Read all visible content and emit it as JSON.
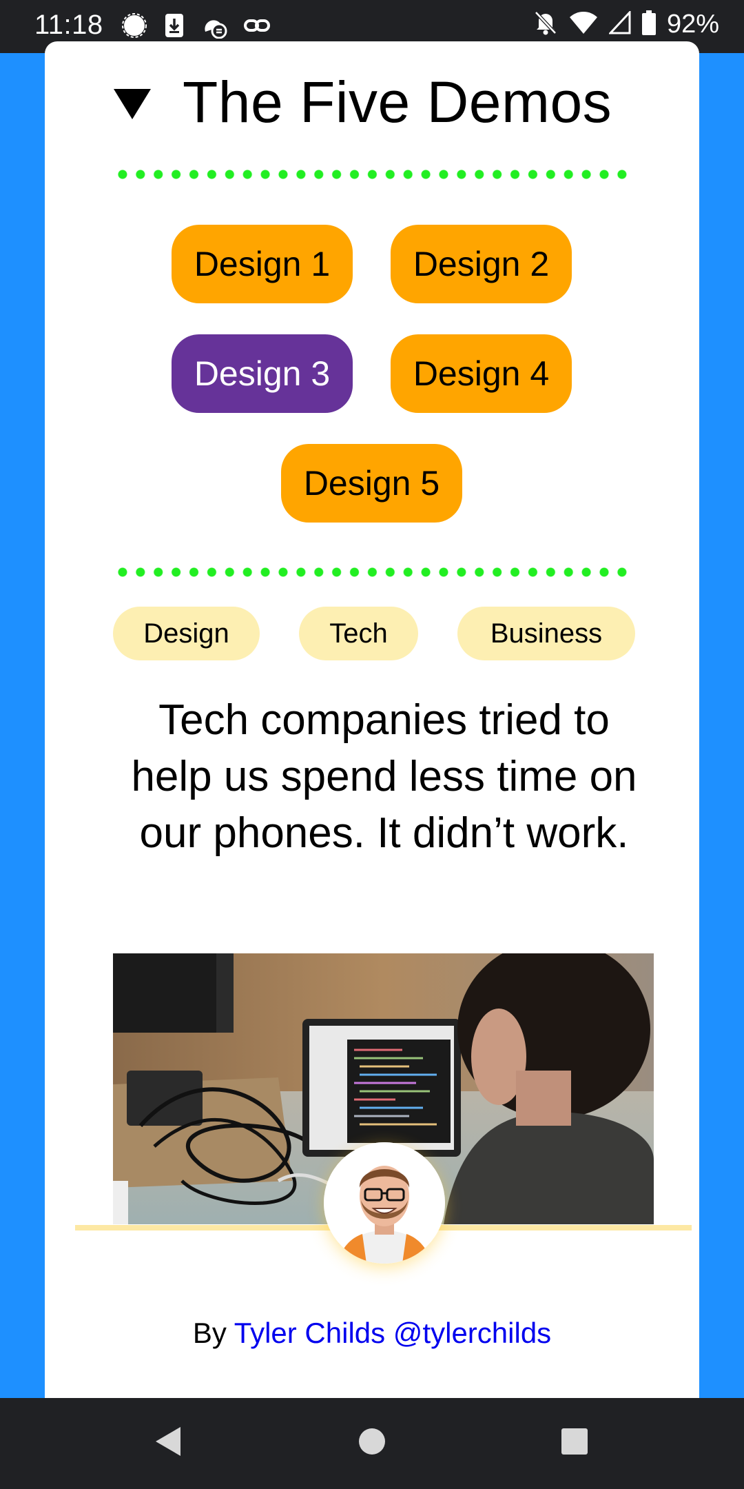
{
  "status_bar": {
    "time": "11:18",
    "left_icons": [
      "signal-chat-icon",
      "download-icon",
      "sync-cloud-icon",
      "link-icon"
    ],
    "right_icons": [
      "bell-off-icon",
      "wifi-icon",
      "cell-signal-icon",
      "battery-icon"
    ],
    "battery": "92%"
  },
  "demos": {
    "title": "The Five Demos",
    "buttons": [
      {
        "label": "Design 1",
        "active": false
      },
      {
        "label": "Design 2",
        "active": false
      },
      {
        "label": "Design 3",
        "active": true
      },
      {
        "label": "Design 4",
        "active": false
      },
      {
        "label": "Design 5",
        "active": false
      }
    ]
  },
  "tags": [
    "Design",
    "Tech",
    "Business"
  ],
  "article": {
    "headline": "Tech companies tried to help us spend less time on our phones. It didn’t work.",
    "byline_prefix": "By",
    "author": "Tyler Childs @tylerchilds"
  },
  "colors": {
    "page_background": "#1e90ff",
    "button_default": "#ffa500",
    "button_active": "#663399",
    "tag_background": "#fdefb2",
    "dotted_divider": "#22ee22",
    "author_link": "#0000ee"
  },
  "nav_bar": {
    "icons": [
      "back-icon",
      "home-icon",
      "recents-icon"
    ]
  }
}
